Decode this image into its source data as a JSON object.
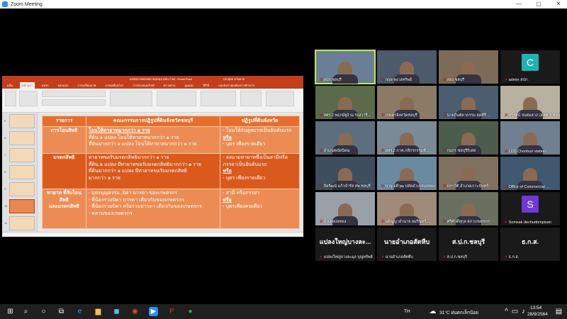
{
  "window": {
    "title": "Zoom Meeting",
    "controls": [
      "—",
      "▢",
      "✕"
    ]
  },
  "ppt": {
    "doc_title": "ผลสัมนาบทสนทนาคนสมุน สปน.? 66 - PowerPoint",
    "user": "ประยุทธ มโนมาย",
    "tabs": [
      "แฟ้ม",
      "หน้าแรก",
      "แทรก",
      "ออกแบบ",
      "การเปลี่ยนภาพ",
      "ภาพเคลื่อนไหว",
      "การนำเสนอสไลด์",
      "ตรวจทาน",
      "มุมมอง",
      "วิธีใช้",
      "บอกฉันว่าคุณต้องการทำอะไร"
    ],
    "active_tab": "หน้าแรก",
    "slide_numbers": [
      "5",
      "6",
      "7",
      "8",
      "9",
      "10",
      "11"
    ],
    "slide": {
      "headers": [
        "รายการ",
        "คณะกรรมการปฏิรูปที่ดินจังหวัดชลบุรี",
        "ปฏิรูปที่ดินจังหวัด"
      ],
      "rows": [
        {
          "item": "การโอนสิทธิ",
          "center": [
            "โอนให้ทายาทมากกว่า ๑ ราย",
            "ที่ดิน ๑ แปลง โอนให้ทายาทมากกว่า ๑ ราย",
            "ที่ดินมากกว่า ๑ แปลง โอนให้ทายาทมากกว่า ๑ ราย"
          ],
          "right": [
            "- โอนให้กับคู่สมรสเป็นอันดับแรก",
            "หรือ",
            "- บุตร เพียงรายเดียว"
          ]
        },
        {
          "item": "มรดกสิทธิ",
          "center": [
            "ทายาทขอรับมรดกสิทธิมากกว่า ๑ ราย",
            "ที่ดิน ๑ แปลง มีทายาทขอรับมรดกสิทธิมากกว่า ๑ ราย",
            "ที่ดินมากกว่า ๑ แปลง มีทายาทขอรับมรดกสิทธิ",
            "มากกว่า ๑ ราย"
          ],
          "right": [
            "- ลงนามทายาทซึ่งเป็นสามีหรือ",
            "ภรรยาเป็นอันดับแรก",
            "หรือ",
            "- บุตร เพียงรายเดียว"
          ]
        },
        {
          "item": "ทายาท ที่รับโอนสิทธิ\nและมรดกสิทธิ",
          "center": [
            "- บุตรบุญธรรม ,บิดา มารดา ของเกษตรกร",
            "- พี่น้องร่วมบิดา มารดา เดียวกันของเกษตรกร",
            "- พี่น้องร่วมบิดา หรือร่วมมารดา เดียวกันของเกษตรกร",
            "- หลานของเกษตรกร"
          ],
          "right": [
            "- สามี หรือภรรยา",
            "หรือ",
            "- บุตรเพียงคนเดียว"
          ]
        }
      ]
    }
  },
  "participants": [
    {
      "name": "สปก.ชลบุรี",
      "big": "",
      "avatar": ""
    },
    {
      "name": "กฤษ พงวงทรัพย์",
      "big": "",
      "avatar": ""
    },
    {
      "name": "สอง ชลบุรี",
      "big": "",
      "avatar": ""
    },
    {
      "name": "admin สปก.",
      "big": "",
      "avatar": "C"
    },
    {
      "name": "สศร.2 พฤกษ์ยูงิ ณ ร่องวารี...",
      "big": "",
      "avatar": ""
    },
    {
      "name": "เกษตรจังหวัดชลบุรี",
      "big": "",
      "avatar": ""
    },
    {
      "name": "นายกันต์ดาธรรม สุดคีรี ...",
      "big": "",
      "avatar": ""
    },
    {
      "name": "สุรีรัตน์ จบสมลาภ (ตลต.จ.ชลบุรี)",
      "big": "",
      "avatar": ""
    },
    {
      "name": "อำเภอพนัสนิคม",
      "big": "",
      "avatar": ""
    },
    {
      "name": "สสร.2 ภาค.กสิกรกรรมชั...",
      "big": "",
      "avatar": ""
    },
    {
      "name": "กนกร ชลบุรีกิเลท",
      "big": "",
      "avatar": ""
    },
    {
      "name": "LDD Chonburi station",
      "big": "",
      "avatar": ""
    },
    {
      "name": "ปัยรัฒน์ แก้วจำรัส สพ.ชลบุรี",
      "big": "",
      "avatar": ""
    },
    {
      "name": "นวยู อติวุฒ ปลัดอำเภอบ่อทอง",
      "big": "",
      "avatar": ""
    },
    {
      "name": "ปภาวัติ อำเภอเกาะจันทร์",
      "big": "",
      "avatar": ""
    },
    {
      "name": "Office of Commercial ...",
      "big": "",
      "avatar": ""
    },
    {
      "name": "อำเภอบ่อทอง",
      "big": "",
      "avatar": ""
    },
    {
      "name": "อดิญญาอำนาจ อมรินทร์...",
      "big": "",
      "avatar": ""
    },
    {
      "name": "ศรีศักดิ์ทุกุล สภาเกษตรกร",
      "big": "",
      "avatar": ""
    },
    {
      "name": "Somsak dechudompisan",
      "big": "",
      "avatar": "S"
    },
    {
      "name": "แปลงใหญ่บางละมุง บุญทรัพย์",
      "big": "แปลงใหญ่บางละ...",
      "avatar": ""
    },
    {
      "name": "นายอำเภอสัตหีบ",
      "big": "นายอำเภอสัตหีบ",
      "avatar": ""
    },
    {
      "name": "ส.ป.ก.ชลบุรี",
      "big": "ส.ป.ก.ชลบุรี",
      "avatar": ""
    },
    {
      "name": "ธ.ก.ส.",
      "big": "ธ.ก.ส.",
      "avatar": ""
    }
  ],
  "taskbar": {
    "lang": "TH",
    "weather": "31°C  ฝนตกเล็กน้อย",
    "time": "13:54",
    "date": "28/9/2564"
  }
}
